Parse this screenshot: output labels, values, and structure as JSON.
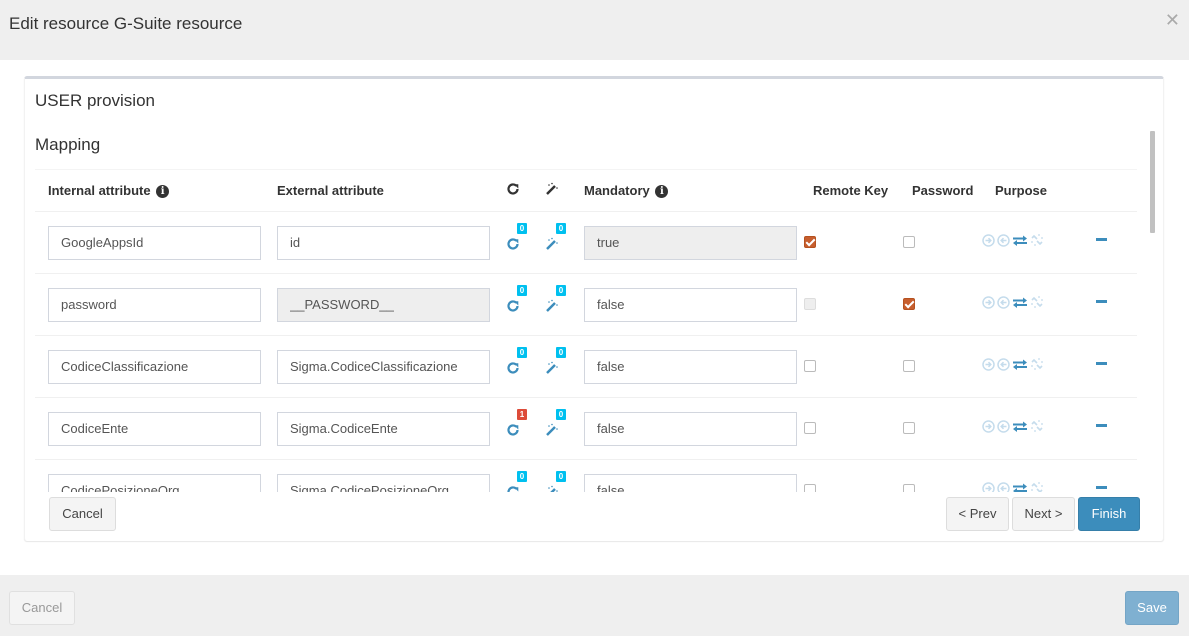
{
  "modal": {
    "title": "Edit resource G-Suite resource",
    "close_icon": "close-icon"
  },
  "box": {
    "title": "USER provision",
    "section": "Mapping"
  },
  "table": {
    "headers": {
      "internal": "Internal attribute",
      "external": "External attribute",
      "transformers_icon": "refresh-icon",
      "jexl_icon": "magic-wand-icon",
      "mandatory": "Mandatory",
      "remote_key": "Remote Key",
      "password": "Password",
      "purpose": "Purpose"
    },
    "rows": [
      {
        "internal": "GoogleAppsId",
        "external": "id",
        "external_readonly": false,
        "transformers": "0",
        "transformers_alert": false,
        "jexl": "0",
        "mandatory": "true",
        "mandatory_readonly": true,
        "remote_key": "checked",
        "password": "unchecked",
        "purpose": "both"
      },
      {
        "internal": "password",
        "external": "__PASSWORD__",
        "external_readonly": true,
        "transformers": "0",
        "transformers_alert": false,
        "jexl": "0",
        "mandatory": "false",
        "mandatory_readonly": false,
        "remote_key": "disabled",
        "password": "checked",
        "purpose": "both"
      },
      {
        "internal": "CodiceClassificazione",
        "external": "Sigma.CodiceClassificazione",
        "external_readonly": false,
        "transformers": "0",
        "transformers_alert": false,
        "jexl": "0",
        "mandatory": "false",
        "mandatory_readonly": false,
        "remote_key": "unchecked",
        "password": "unchecked",
        "purpose": "both"
      },
      {
        "internal": "CodiceEnte",
        "external": "Sigma.CodiceEnte",
        "external_readonly": false,
        "transformers": "1",
        "transformers_alert": true,
        "jexl": "0",
        "mandatory": "false",
        "mandatory_readonly": false,
        "remote_key": "unchecked",
        "password": "unchecked",
        "purpose": "both"
      },
      {
        "internal": "CodicePosizioneOrg",
        "external": "Sigma.CodicePosizioneOrg",
        "external_readonly": false,
        "transformers": "0",
        "transformers_alert": false,
        "jexl": "0",
        "mandatory": "false",
        "mandatory_readonly": false,
        "remote_key": "unchecked",
        "password": "unchecked",
        "purpose": "both"
      }
    ]
  },
  "wizard": {
    "cancel": "Cancel",
    "prev": "< Prev",
    "next": "Next >",
    "finish": "Finish"
  },
  "footer": {
    "cancel": "Cancel",
    "save": "Save"
  },
  "colors": {
    "primary": "#3c8dbc",
    "badge_info": "#00c0ef",
    "badge_alert": "#dd4b39",
    "checkbox_checked": "#c75e2e",
    "purpose_inactive": "#c5dcec"
  }
}
